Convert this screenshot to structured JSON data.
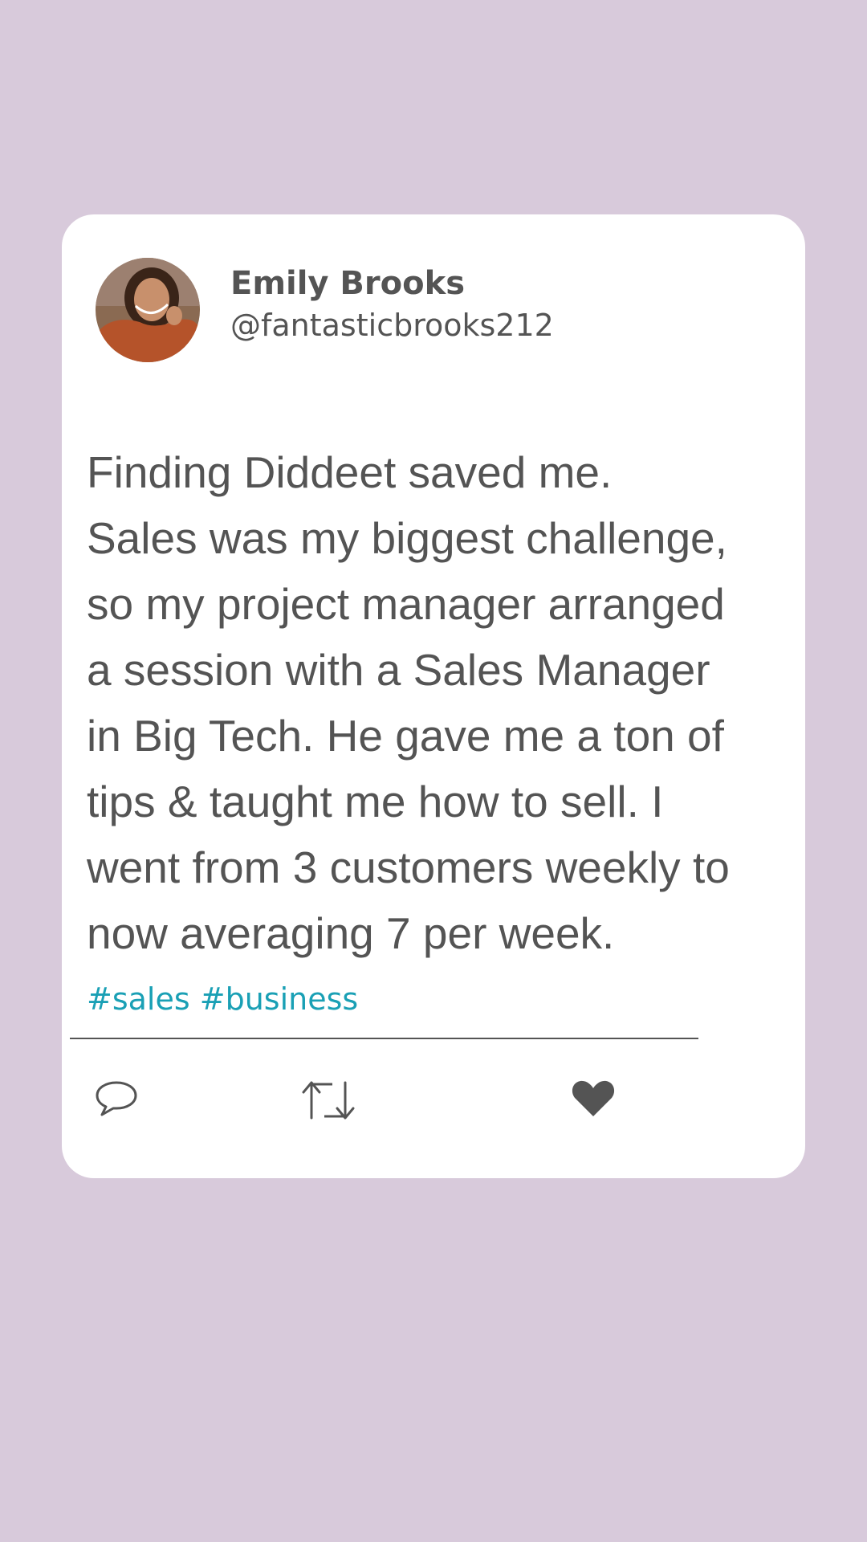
{
  "post": {
    "author_name": "Emily Brooks",
    "author_handle": "@fantasticbrooks212",
    "body_lines": [
      "Finding Diddeet saved me.",
      "Sales was my biggest challenge,",
      "so my project manager arranged",
      "a session with a Sales Manager",
      "in Big Tech. He gave me a ton of",
      "tips & taught me how to sell. I",
      "went from 3 customers weekly to",
      "now averaging 7 per week."
    ],
    "hashtags": "#sales #business"
  },
  "actions": [
    {
      "name": "reply",
      "icon": "speech-bubble-icon"
    },
    {
      "name": "repost",
      "icon": "repost-arrows-icon"
    },
    {
      "name": "like",
      "icon": "heart-icon"
    }
  ],
  "colors": {
    "background": "#d8cadb",
    "card": "#ffffff",
    "text": "#545454",
    "hashtag": "#1aa0b5"
  }
}
